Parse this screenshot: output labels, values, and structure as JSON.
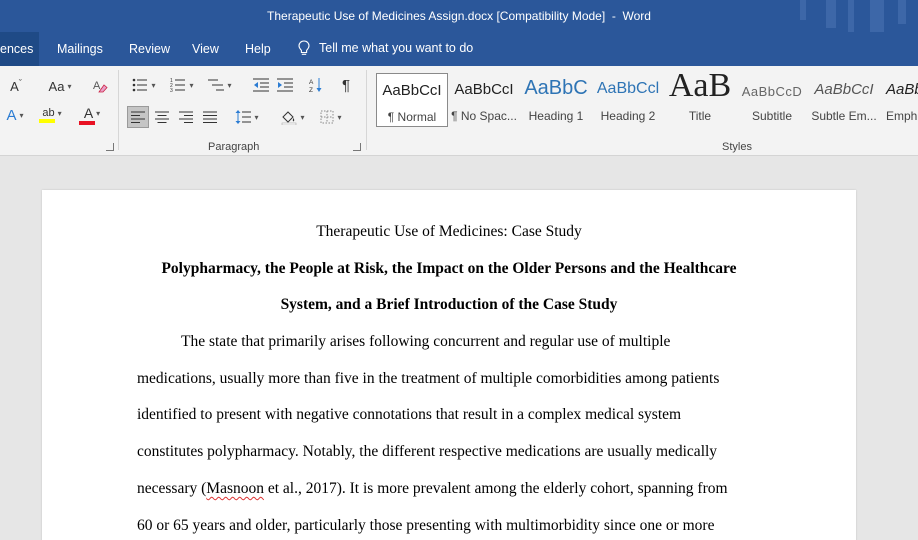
{
  "titlebar": {
    "title": "Therapeutic Use of Medicines Assign.docx [Compatibility Mode]  -  Word"
  },
  "ribbon_tabs": {
    "active": "ences",
    "items": [
      "Mailings",
      "Review",
      "View",
      "Help"
    ],
    "tell_me": "Tell me what you want to do"
  },
  "font_group": {
    "shrink_label": "A",
    "case_label": "Aa",
    "effects_label": "A",
    "highlight_label": "ab",
    "font_color_label": "A",
    "highlight_color": "#ffff00",
    "font_color": "#e81123"
  },
  "paragraph_group": {
    "label": "Paragraph",
    "pilcrow": "¶"
  },
  "styles_group": {
    "label": "Styles",
    "tiles": [
      {
        "sample": "AaBbCcI",
        "name": "¶ Normal"
      },
      {
        "sample": "AaBbCcI",
        "name": "¶ No Spac..."
      },
      {
        "sample": "AaBbC",
        "name": "Heading 1"
      },
      {
        "sample": "AaBbCcl",
        "name": "Heading 2"
      },
      {
        "sample": "AaB",
        "name": "Title"
      },
      {
        "sample": "AaBbCcD",
        "name": "Subtitle"
      },
      {
        "sample": "AaBbCcI",
        "name": "Subtle Em..."
      },
      {
        "sample": "AaBb",
        "name": "Emph"
      }
    ]
  },
  "document": {
    "title": "Therapeutic Use of Medicines: Case Study",
    "heading_line1": "Polypharmacy, the People at Risk, the Impact on the Older Persons and the Healthcare",
    "heading_line2": "System, and a Brief Introduction of the Case Study",
    "body": [
      "The state that primarily arises following concurrent and regular use of multiple",
      "medications, usually more than five in the treatment of multiple comorbidities among patients",
      "identified to present with negative connotations that result in a complex medical system",
      "constitutes polypharmacy. Notably, the different respective medications are usually medically"
    ],
    "line5_before": "necessary (",
    "line5_flagged": "Masnoon",
    "line5_after": " et al., 2017). It is more prevalent among the elderly cohort, spanning from",
    "line6": "60 or 65 years and older, particularly those presenting with multimorbidity since one or more"
  }
}
